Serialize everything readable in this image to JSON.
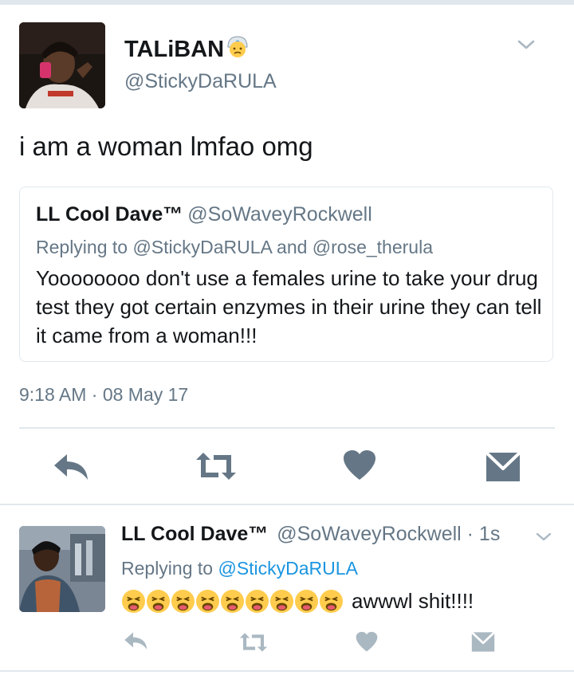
{
  "tweet": {
    "display_name": "TALiBAN",
    "handle": "@StickyDaRULA",
    "text": "i am a woman lmfao omg",
    "timestamp": "9:18 AM · 08 May 17",
    "avatar_icon": "user-photo-avatar",
    "name_emoji": "worried-face-turban-emoji"
  },
  "quoted_tweet": {
    "display_name": "LL Cool Dave™",
    "handle": "@SoWaveyRockwell",
    "replying_to": "Replying to @StickyDaRULA and @rose_therula",
    "text": "Yoooooooo don't use a females urine to take your drug test they got certain enzymes in their urine they can tell it came from a woman!!!"
  },
  "actions": [
    "reply-icon",
    "retweet-icon",
    "like-icon",
    "direct-message-icon"
  ],
  "reply_tweet": {
    "display_name": "LL Cool Dave™",
    "handle": "@SoWaveyRockwell · 1s",
    "replying_label": "Replying to",
    "replying_mention": "@StickyDaRULA",
    "emoji": "tired-face-emoji",
    "emoji_count": 9,
    "text": "awwwl shit!!!!",
    "avatar_icon": "user-photo-avatar"
  },
  "colors": {
    "icon_gray": "#657786",
    "light_icon_gray": "#aab8c2",
    "mention_blue": "#1b95e0",
    "border": "#e1e8ed"
  }
}
